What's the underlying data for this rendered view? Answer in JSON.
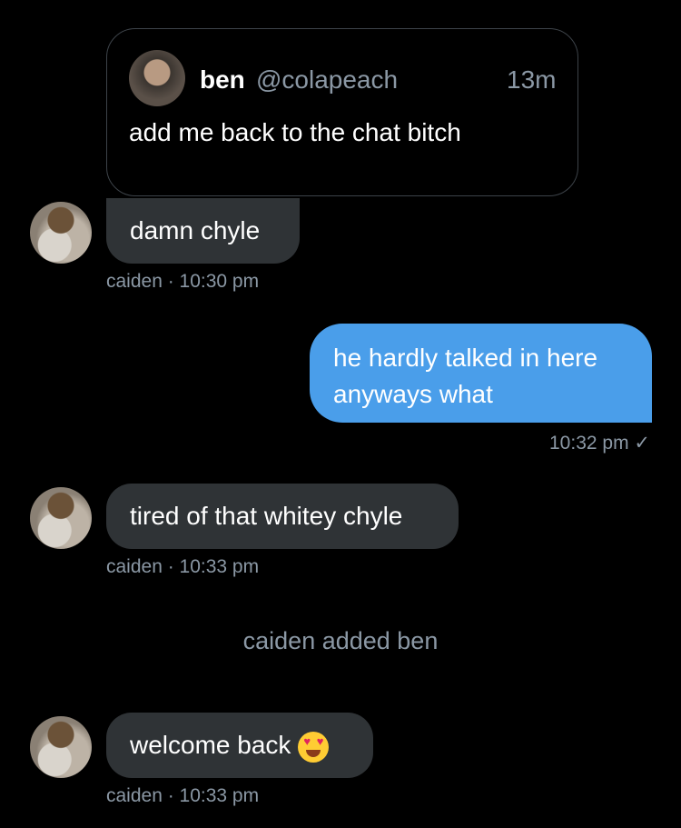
{
  "quoted_tweet": {
    "name": "ben",
    "handle": "@colapeach",
    "time": "13m",
    "text": "add me back to the chat bitch"
  },
  "messages": [
    {
      "text": "damn chyle",
      "meta": "caiden · 10:30 pm"
    },
    {
      "text": "he hardly talked in here anyways what",
      "meta": "10:32 pm ✓"
    },
    {
      "text": "tired of that whitey chyle",
      "meta": "caiden · 10:33 pm"
    },
    {
      "system": "caiden added ben"
    },
    {
      "text": "welcome back",
      "emoji": "heart-eyes-emoji",
      "meta": "caiden · 10:33 pm"
    }
  ],
  "colors": {
    "background": "#000000",
    "incoming_bubble": "#2f3336",
    "outgoing_bubble": "#4a9eea",
    "meta_text": "#8b98a5"
  }
}
